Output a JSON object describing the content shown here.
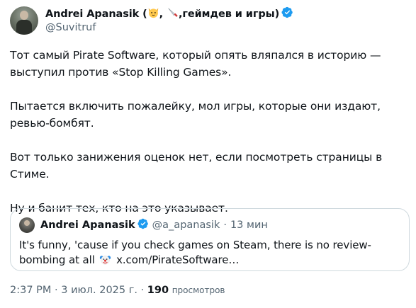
{
  "tweet": {
    "author": {
      "display_name": "Andrei Apanasik (",
      "display_name_tail": ",геймдев и игры)",
      "handle": "@Suvitruf"
    },
    "paragraphs": [
      "Тот самый Pirate Software, который опять вляпался в историю — выступил против «Stop Killing Games».",
      "Пытается включить пожалейку, мол игры, которые они издают, ревью-бомбят.",
      "Вот только занижения оценок нет, если посмотреть страницы в Стиме.",
      "Ну и банит тех, кто на это указывает."
    ],
    "meta": {
      "time": "2:37 PM",
      "dot": "·",
      "date": "3 июл. 2025 г.",
      "dot2": "·",
      "views_count": "190",
      "views_label": "просмотров"
    }
  },
  "quote": {
    "display_name": "Andrei Apanasik",
    "handle": "@a_apanasik",
    "separator": "·",
    "time": "13 мин",
    "text_before": "It's funny, 'cause if you check games on Steam, there is no review-bombing at all",
    "text_after": "x.com/PirateSoftware…"
  },
  "colors": {
    "text": "#0f1419",
    "secondary": "#536471",
    "verified": "#1d9bf0",
    "border": "#cfd9de"
  },
  "icons": [
    "cat-emoji-icon",
    "knife-emoji-icon",
    "verified-badge-icon",
    "clown-emoji-icon"
  ]
}
